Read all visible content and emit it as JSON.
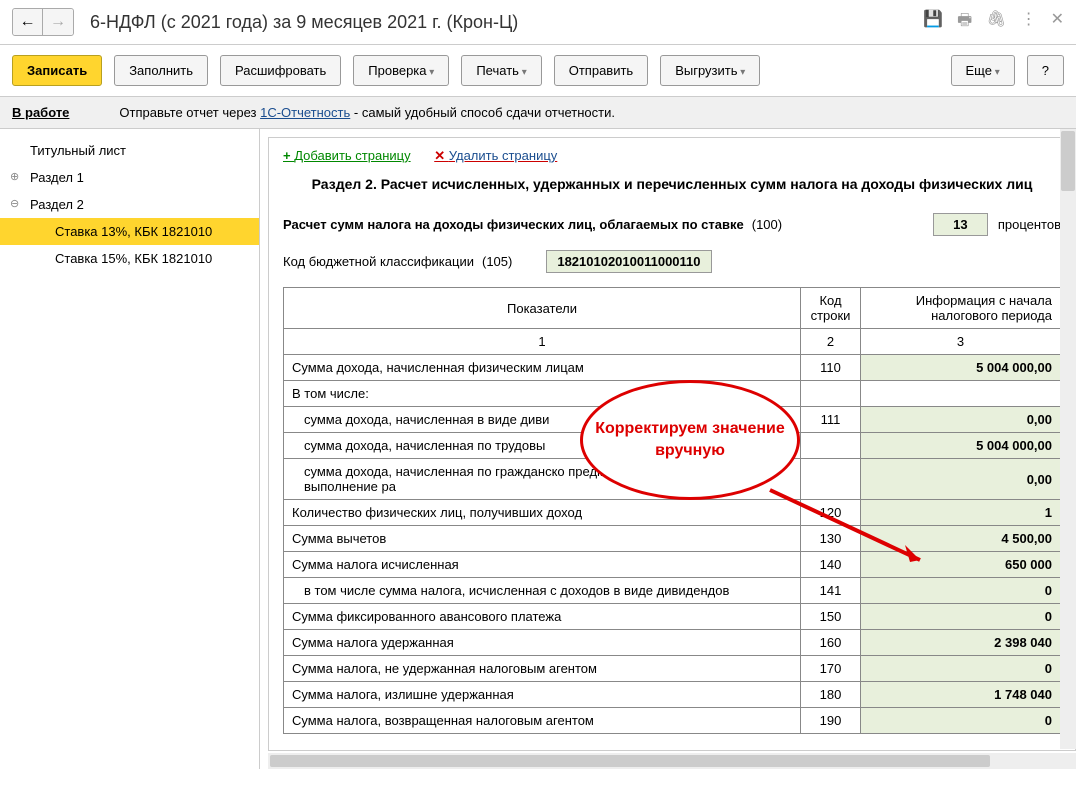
{
  "header": {
    "title": "6-НДФЛ (с 2021 года) за 9 месяцев 2021 г. (Крон-Ц)"
  },
  "toolbar": {
    "save": "Записать",
    "fill": "Заполнить",
    "decrypt": "Расшифровать",
    "check": "Проверка",
    "print": "Печать",
    "send": "Отправить",
    "export": "Выгрузить",
    "more": "Еще",
    "help": "?"
  },
  "infobar": {
    "status": "В работе",
    "text1": "Отправьте отчет через ",
    "link": "1С-Отчетность",
    "text2": " - самый удобный способ сдачи отчетности."
  },
  "tree": {
    "title_page": "Титульный лист",
    "section1": "Раздел 1",
    "section2": "Раздел 2",
    "child1": "Ставка 13%, КБК 1821010",
    "child2": "Ставка 15%, КБК 1821010"
  },
  "page_actions": {
    "add": "Добавить страницу",
    "del": "Удалить страницу"
  },
  "section": {
    "title": "Раздел 2. Расчет исчисленных, удержанных и перечисленных сумм налога на доходы физических лиц",
    "calc_label": "Расчет сумм налога на доходы физических лиц, облагаемых по ставке",
    "calc_code": "(100)",
    "rate": "13",
    "rate_unit": "процентов",
    "kbk_label": "Код бюджетной классификации",
    "kbk_code": "(105)",
    "kbk_value": "18210102010011000110"
  },
  "table": {
    "headers": {
      "col1": "Показатели",
      "col2": "Код строки",
      "col3": "Информация с начала налогового периода"
    },
    "num_row": {
      "c1": "1",
      "c2": "2",
      "c3": "3"
    },
    "rows": [
      {
        "name": "Сумма дохода, начисленная физическим лицам",
        "code": "110",
        "val": "5 004 000,00"
      },
      {
        "name": "В том числе:",
        "code": "",
        "val": "",
        "header": true
      },
      {
        "name": "сумма дохода, начисленная в виде диви",
        "code": "111",
        "val": "0,00",
        "indent": true
      },
      {
        "name": "сумма дохода, начисленная по трудовы",
        "code": "",
        "val": "5 004 000,00",
        "indent": true
      },
      {
        "name": "сумма дохода, начисленная по гражданско предметом которых являются выполнение ра",
        "code": "",
        "val": "0,00",
        "indent": true
      },
      {
        "name": "Количество физических лиц, получивших доход",
        "code": "120",
        "val": "1"
      },
      {
        "name": "Сумма вычетов",
        "code": "130",
        "val": "4 500,00"
      },
      {
        "name": "Сумма налога исчисленная",
        "code": "140",
        "val": "650 000"
      },
      {
        "name": "в том числе сумма налога, исчисленная с доходов в виде дивидендов",
        "code": "141",
        "val": "0",
        "indent": true
      },
      {
        "name": "Сумма фиксированного авансового платежа",
        "code": "150",
        "val": "0"
      },
      {
        "name": "Сумма налога удержанная",
        "code": "160",
        "val": "2 398 040"
      },
      {
        "name": "Сумма налога, не удержанная налоговым агентом",
        "code": "170",
        "val": "0"
      },
      {
        "name": "Сумма налога, излишне удержанная",
        "code": "180",
        "val": "1 748 040"
      },
      {
        "name": "Сумма налога, возвращенная налоговым агентом",
        "code": "190",
        "val": "0"
      }
    ]
  },
  "callout": "Корректируем значение вручную"
}
